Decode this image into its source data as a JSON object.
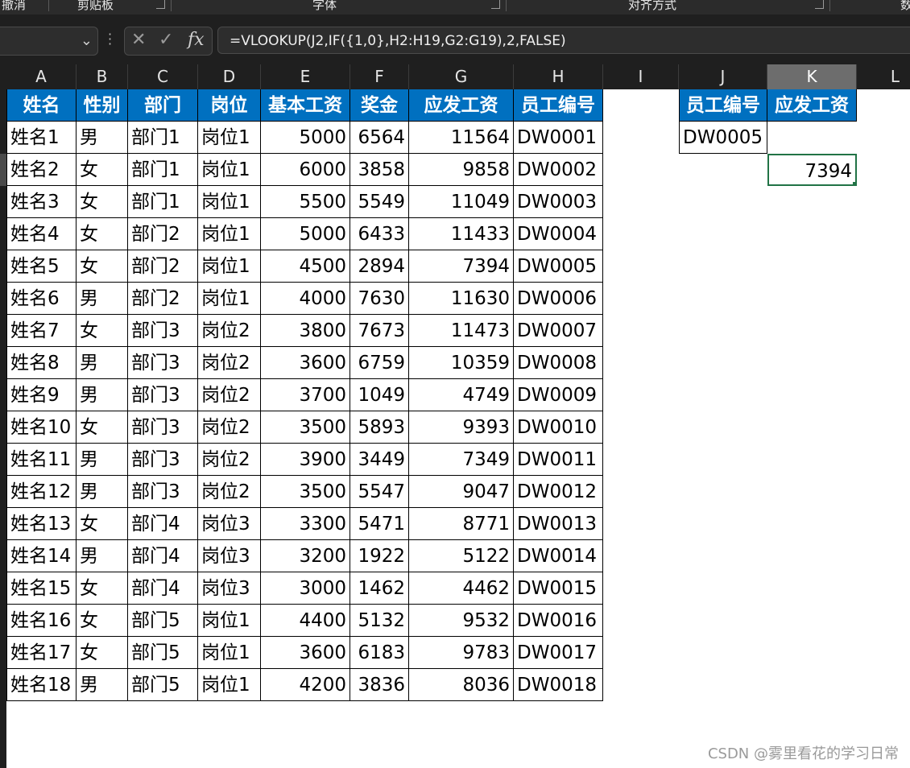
{
  "ribbon": {
    "groups": [
      "撤消",
      "剪贴板",
      "字体",
      "对齐方式",
      "数"
    ]
  },
  "formula_bar": {
    "name_box": "",
    "cancel_symbol": "✕",
    "enter_symbol": "✓",
    "fx_symbol": "fx",
    "formula": "=VLOOKUP(J2,IF({1,0},H2:H19,G2:G19),2,FALSE)"
  },
  "columns": [
    "A",
    "B",
    "C",
    "D",
    "E",
    "F",
    "G",
    "H",
    "I",
    "J",
    "K",
    "L"
  ],
  "selected_column": "K",
  "table": {
    "headers": [
      "姓名",
      "性别",
      "部门",
      "岗位",
      "基本工资",
      "奖金",
      "应发工资",
      "员工编号"
    ],
    "rows": [
      [
        "姓名1",
        "男",
        "部门1",
        "岗位1",
        "5000",
        "6564",
        "11564",
        "DW0001"
      ],
      [
        "姓名2",
        "女",
        "部门1",
        "岗位1",
        "6000",
        "3858",
        "9858",
        "DW0002"
      ],
      [
        "姓名3",
        "女",
        "部门1",
        "岗位1",
        "5500",
        "5549",
        "11049",
        "DW0003"
      ],
      [
        "姓名4",
        "女",
        "部门2",
        "岗位1",
        "5000",
        "6433",
        "11433",
        "DW0004"
      ],
      [
        "姓名5",
        "女",
        "部门2",
        "岗位1",
        "4500",
        "2894",
        "7394",
        "DW0005"
      ],
      [
        "姓名6",
        "男",
        "部门2",
        "岗位1",
        "4000",
        "7630",
        "11630",
        "DW0006"
      ],
      [
        "姓名7",
        "女",
        "部门3",
        "岗位2",
        "3800",
        "7673",
        "11473",
        "DW0007"
      ],
      [
        "姓名8",
        "男",
        "部门3",
        "岗位2",
        "3600",
        "6759",
        "10359",
        "DW0008"
      ],
      [
        "姓名9",
        "男",
        "部门3",
        "岗位2",
        "3700",
        "1049",
        "4749",
        "DW0009"
      ],
      [
        "姓名10",
        "女",
        "部门3",
        "岗位2",
        "3500",
        "5893",
        "9393",
        "DW0010"
      ],
      [
        "姓名11",
        "男",
        "部门3",
        "岗位2",
        "3900",
        "3449",
        "7349",
        "DW0011"
      ],
      [
        "姓名12",
        "男",
        "部门3",
        "岗位2",
        "3500",
        "5547",
        "9047",
        "DW0012"
      ],
      [
        "姓名13",
        "女",
        "部门4",
        "岗位3",
        "3300",
        "5471",
        "8771",
        "DW0013"
      ],
      [
        "姓名14",
        "男",
        "部门4",
        "岗位3",
        "3200",
        "1922",
        "5122",
        "DW0014"
      ],
      [
        "姓名15",
        "女",
        "部门4",
        "岗位3",
        "3000",
        "1462",
        "4462",
        "DW0015"
      ],
      [
        "姓名16",
        "女",
        "部门5",
        "岗位1",
        "4400",
        "5132",
        "9532",
        "DW0016"
      ],
      [
        "姓名17",
        "女",
        "部门5",
        "岗位1",
        "3600",
        "6183",
        "9783",
        "DW0017"
      ],
      [
        "姓名18",
        "男",
        "部门5",
        "岗位1",
        "4200",
        "3836",
        "8036",
        "DW0018"
      ]
    ]
  },
  "lookup": {
    "headers": [
      "员工编号",
      "应发工资"
    ],
    "key": "DW0005",
    "result": "7394"
  },
  "watermark": "CSDN @雾里看花的学习日常",
  "colors": {
    "header_fill": "#0070c0",
    "selection": "#217346",
    "dark_chrome": "#1f1f1f"
  }
}
